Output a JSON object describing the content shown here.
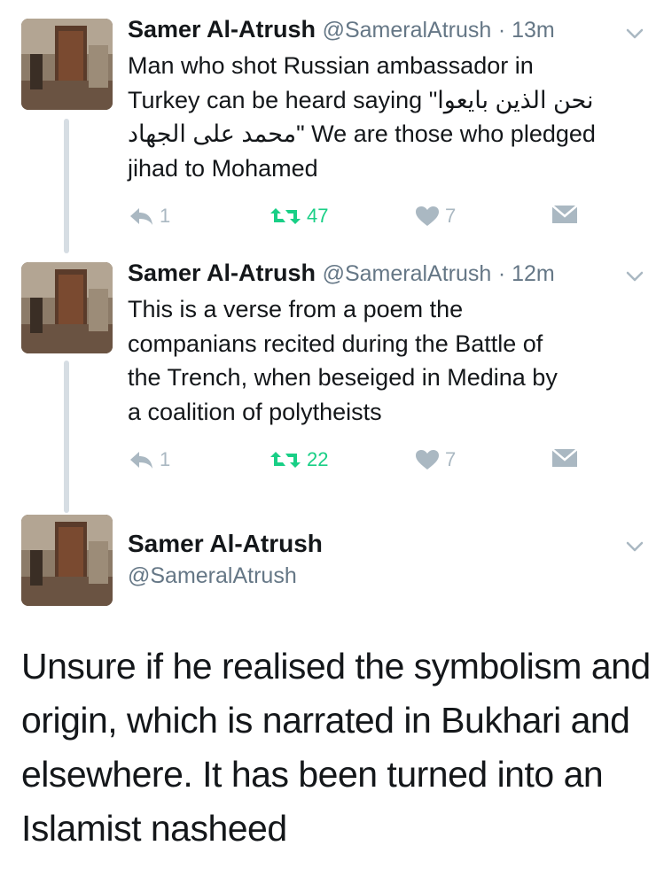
{
  "tweets": [
    {
      "name": "Samer Al-Atrush",
      "handle": "@SameralAtrush",
      "time": "· 13m",
      "text": "Man who shot Russian ambassador in\nTurkey can be heard saying \"نحن الذين بايعوا\nمحمد على الجهاد\" We are those who pledged\njihad to Mohamed",
      "replies": "1",
      "retweets": "47",
      "likes": "7"
    },
    {
      "name": "Samer Al-Atrush",
      "handle": "@SameralAtrush",
      "time": "· 12m",
      "text": "This is a verse from a poem the\ncompanians recited during the Battle of\nthe Trench, when beseiged in Medina by\na coalition of polytheists",
      "replies": "1",
      "retweets": "22",
      "likes": "7"
    }
  ],
  "main_tweet": {
    "name": "Samer Al-Atrush",
    "handle": "@SameralAtrush",
    "text": "Unsure if he realised the symbolism and origin, which is narrated in Bukhari and elsewhere. It has been turned into an Islamist nasheed"
  },
  "colors": {
    "retweet_green": "#19cf86",
    "muted_gray": "#aab8c2",
    "handle_gray": "#657786",
    "thread_line": "#d6dde3"
  },
  "icons": [
    "reply-icon",
    "retweet-icon",
    "like-icon",
    "direct-message-icon",
    "chevron-down-icon"
  ]
}
